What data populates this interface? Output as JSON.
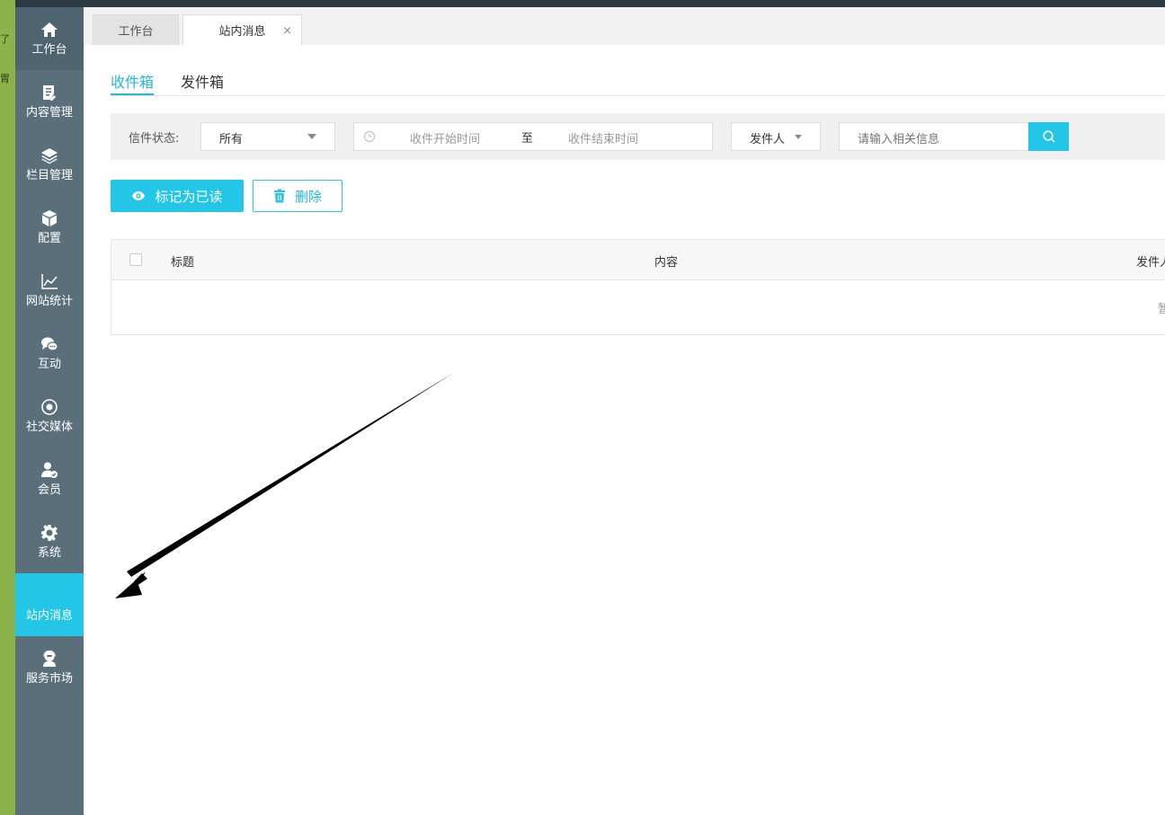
{
  "edge_glyphs": [
    "了",
    "胃"
  ],
  "sidebar": {
    "items": [
      {
        "label": "工作台",
        "icon": "home-icon"
      },
      {
        "label": "内容管理",
        "icon": "document-edit-icon"
      },
      {
        "label": "栏目管理",
        "icon": "layers-icon"
      },
      {
        "label": "配置",
        "icon": "cube-icon"
      },
      {
        "label": "网站统计",
        "icon": "line-chart-icon"
      },
      {
        "label": "互动",
        "icon": "chat-icon"
      },
      {
        "label": "社交媒体",
        "icon": "target-icon"
      },
      {
        "label": "会员",
        "icon": "member-icon"
      },
      {
        "label": "系统",
        "icon": "gear-icon"
      },
      {
        "label": "站内消息",
        "icon": "message-icon"
      },
      {
        "label": "服务市场",
        "icon": "support-icon"
      }
    ]
  },
  "tabs": {
    "workbench": "工作台",
    "messages": "站内消息",
    "close": "×"
  },
  "subtabs": {
    "inbox": "收件箱",
    "outbox": "发件箱"
  },
  "filter": {
    "status_label": "信件状态:",
    "status_value": "所有",
    "start_placeholder": "收件开始时间",
    "separator": "至",
    "end_placeholder": "收件结束时间",
    "sender_value": "发件人",
    "search_placeholder": "请输入相关信息"
  },
  "actions": {
    "mark_read": "标记为已读",
    "delete": "删除"
  },
  "table": {
    "headers": [
      "标题",
      "内容",
      "发件人"
    ],
    "empty_text": "暂"
  },
  "colors": {
    "accent": "#23c6e6",
    "sidebar": "#5a6f7a",
    "edge": "#8bb34a"
  }
}
